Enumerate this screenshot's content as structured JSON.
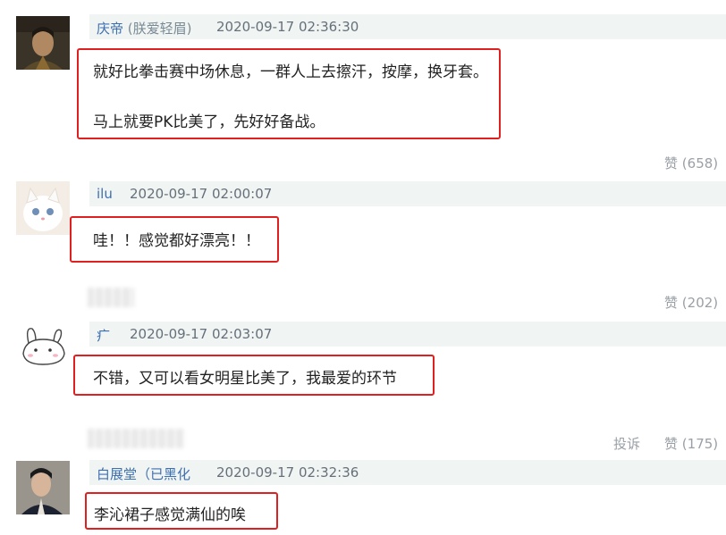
{
  "comments": [
    {
      "username": "庆帝",
      "tag": "(朕爱轻眉)",
      "timestamp": "2020-09-17 02:36:30",
      "lines": [
        "就好比拳击赛中场休息，一群人上去擦汗，按摩，换牙套。",
        "马上就要PK比美了，先好好备战。"
      ],
      "like_label": "赞",
      "like_count": "(658)"
    },
    {
      "username": "ilu",
      "timestamp": "2020-09-17 02:00:07",
      "lines": [
        "哇！！感觉都好漂亮！！"
      ],
      "like_label": "赞",
      "like_count": "(202)"
    },
    {
      "username": "疒",
      "timestamp": "2020-09-17 02:03:07",
      "lines": [
        "不错，又可以看女明星比美了，我最爱的环节"
      ],
      "report_label": "投诉",
      "like_label": "赞",
      "like_count": "(175)"
    },
    {
      "username": "白展堂（已黑化",
      "timestamp": "2020-09-17 02:32:36",
      "lines": [
        "李沁裙子感觉满仙的唉"
      ]
    }
  ],
  "colors": {
    "username": "#3e6fb0",
    "highlight_border": "#e02020",
    "meta_bar": "#f0f5f3"
  },
  "icons": [
    "avatar-man-costume",
    "avatar-white-cat",
    "avatar-bunny-ok-sticker",
    "avatar-man-ancient-costume"
  ]
}
